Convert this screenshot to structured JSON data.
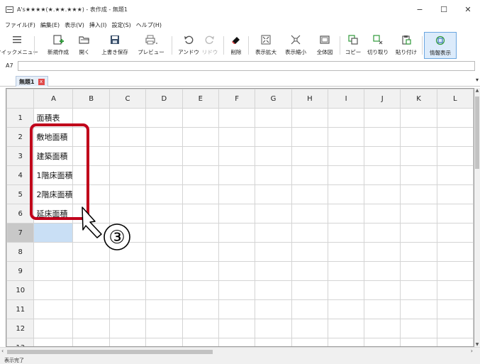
{
  "window": {
    "title": "A's★★★★(★.★★.★★★) - 表作成 - 無題1",
    "controls": {
      "minimize": "−",
      "maximize": "☐",
      "close": "✕"
    }
  },
  "menu": [
    "ファイル(F)",
    "編集(E)",
    "表示(V)",
    "挿入(I)",
    "設定(S)",
    "ヘルプ(H)"
  ],
  "toolbar": {
    "quick_menu": "クイックメニュー",
    "new": "新規作成",
    "open": "開く",
    "overwrite_save": "上書き保存",
    "preview": "プレビュー",
    "undo": "アンドウ",
    "redo": "リドウ",
    "delete": "削除",
    "zoom_in": "表示拡大",
    "zoom_out": "表示縮小",
    "fit_all": "全体図",
    "copy": "コピー",
    "cut": "切り取り",
    "paste": "貼り付け",
    "info_display": "情報表示"
  },
  "formula_bar": {
    "cell_ref": "A7",
    "value": ""
  },
  "sheet_tab": {
    "label": "無題1",
    "close": "x"
  },
  "grid": {
    "columns": [
      "A",
      "B",
      "C",
      "D",
      "E",
      "F",
      "G",
      "H",
      "I",
      "J",
      "K",
      "L"
    ],
    "rows": [
      {
        "num": "1",
        "a": "面積表"
      },
      {
        "num": "2",
        "a": "敷地面積"
      },
      {
        "num": "3",
        "a": "建築面積"
      },
      {
        "num": "4",
        "a": "1階床面積"
      },
      {
        "num": "5",
        "a": "2階床面積"
      },
      {
        "num": "6",
        "a": "延床面積"
      },
      {
        "num": "7",
        "a": ""
      },
      {
        "num": "8",
        "a": ""
      },
      {
        "num": "9",
        "a": ""
      },
      {
        "num": "10",
        "a": ""
      },
      {
        "num": "11",
        "a": ""
      },
      {
        "num": "12",
        "a": ""
      },
      {
        "num": "13",
        "a": ""
      }
    ]
  },
  "status": {
    "text": "表示完了"
  },
  "annotation": {
    "step_number": "③",
    "color": "#c0001b"
  }
}
